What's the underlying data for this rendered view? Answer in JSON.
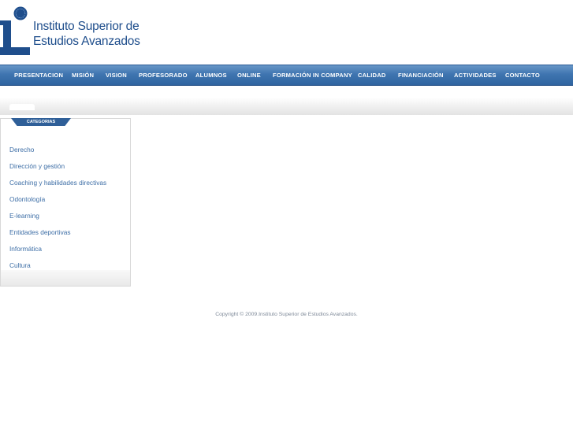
{
  "logo": {
    "line1": "Instituto Superior de",
    "line2": "Estudios Avanzados",
    "icon": "institute-logo-icon",
    "colors": {
      "blue": "#1f4e8c"
    }
  },
  "nav": {
    "items": [
      {
        "label": "PRESENTACION"
      },
      {
        "label": "MISIÓN"
      },
      {
        "label": "VISION"
      },
      {
        "label": "PROFESORADO"
      },
      {
        "label": "ALUMNOS"
      },
      {
        "label": "ONLINE"
      },
      {
        "label": "FORMACIÓN IN COMPANY"
      },
      {
        "label": "CALIDAD"
      },
      {
        "label": "FINANCIACIÓN"
      },
      {
        "label": "ACTIVIDADES"
      },
      {
        "label": "CONTACTO"
      }
    ],
    "colors": {
      "bar": "#3f75b0",
      "text": "#ffffff"
    }
  },
  "sidebar": {
    "title": "CATEGORIAS",
    "items": [
      {
        "label": "Derecho"
      },
      {
        "label": "Dirección y gestión"
      },
      {
        "label": "Coaching y habilidades directivas"
      },
      {
        "label": "Odontología"
      },
      {
        "label": "E-learning"
      },
      {
        "label": "Entidades deportivas"
      },
      {
        "label": "Informática"
      },
      {
        "label": "Cultura"
      }
    ],
    "colors": {
      "link": "#3d6ea6",
      "tab": "#2f5f98"
    }
  },
  "footer": {
    "copyright": "Copyright © 2009.Instituto Superior de Estudios Avanzados."
  }
}
